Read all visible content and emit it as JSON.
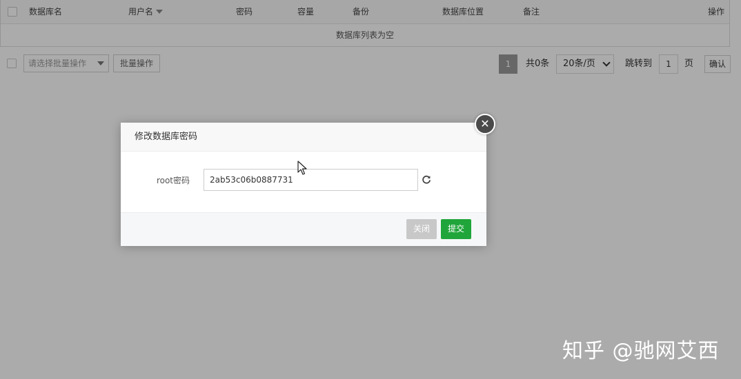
{
  "table": {
    "columns": [
      "数据库名",
      "用户名",
      "密码",
      "容量",
      "备份",
      "数据库位置",
      "备注",
      "操作"
    ],
    "empty_text": "数据库列表为空"
  },
  "toolbar": {
    "batch_select_placeholder": "请选择批量操作",
    "batch_button": "批量操作"
  },
  "pagination": {
    "current_page": "1",
    "total": "共0条",
    "page_size": "20条/页",
    "jump_label": "跳转到",
    "jump_value": "1",
    "page_unit": "页",
    "confirm": "确认"
  },
  "modal": {
    "title": "修改数据库密码",
    "field_label": "root密码",
    "password_value": "2ab53c06b0887731",
    "close_button": "关闭",
    "submit_button": "提交"
  },
  "watermark": "知乎 @驰网艾西",
  "colors": {
    "submit": "#20a53a",
    "close": "#c8c8c8",
    "overlay": "rgba(0,0,0,0.33)"
  },
  "icons": [
    "sort-down-icon",
    "dropdown-arrow-icon",
    "chevron-down-icon",
    "close-icon",
    "refresh-icon",
    "mouse-cursor-icon"
  ]
}
